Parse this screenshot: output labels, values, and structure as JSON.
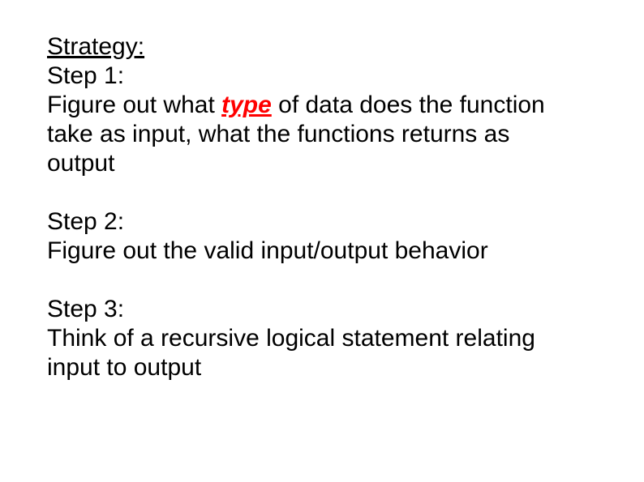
{
  "strategy": {
    "heading": "Strategy:",
    "step1_label": "Step 1:",
    "step1_text_a": "Figure out what ",
    "step1_type": "type",
    "step1_text_b": " of data does the function take as input, what the functions returns as output",
    "step2_label": "Step 2:",
    "step2_text": "Figure out the valid input/output behavior",
    "step3_label": "Step 3:",
    "step3_text": "Think of a recursive logical statement relating input to output"
  }
}
